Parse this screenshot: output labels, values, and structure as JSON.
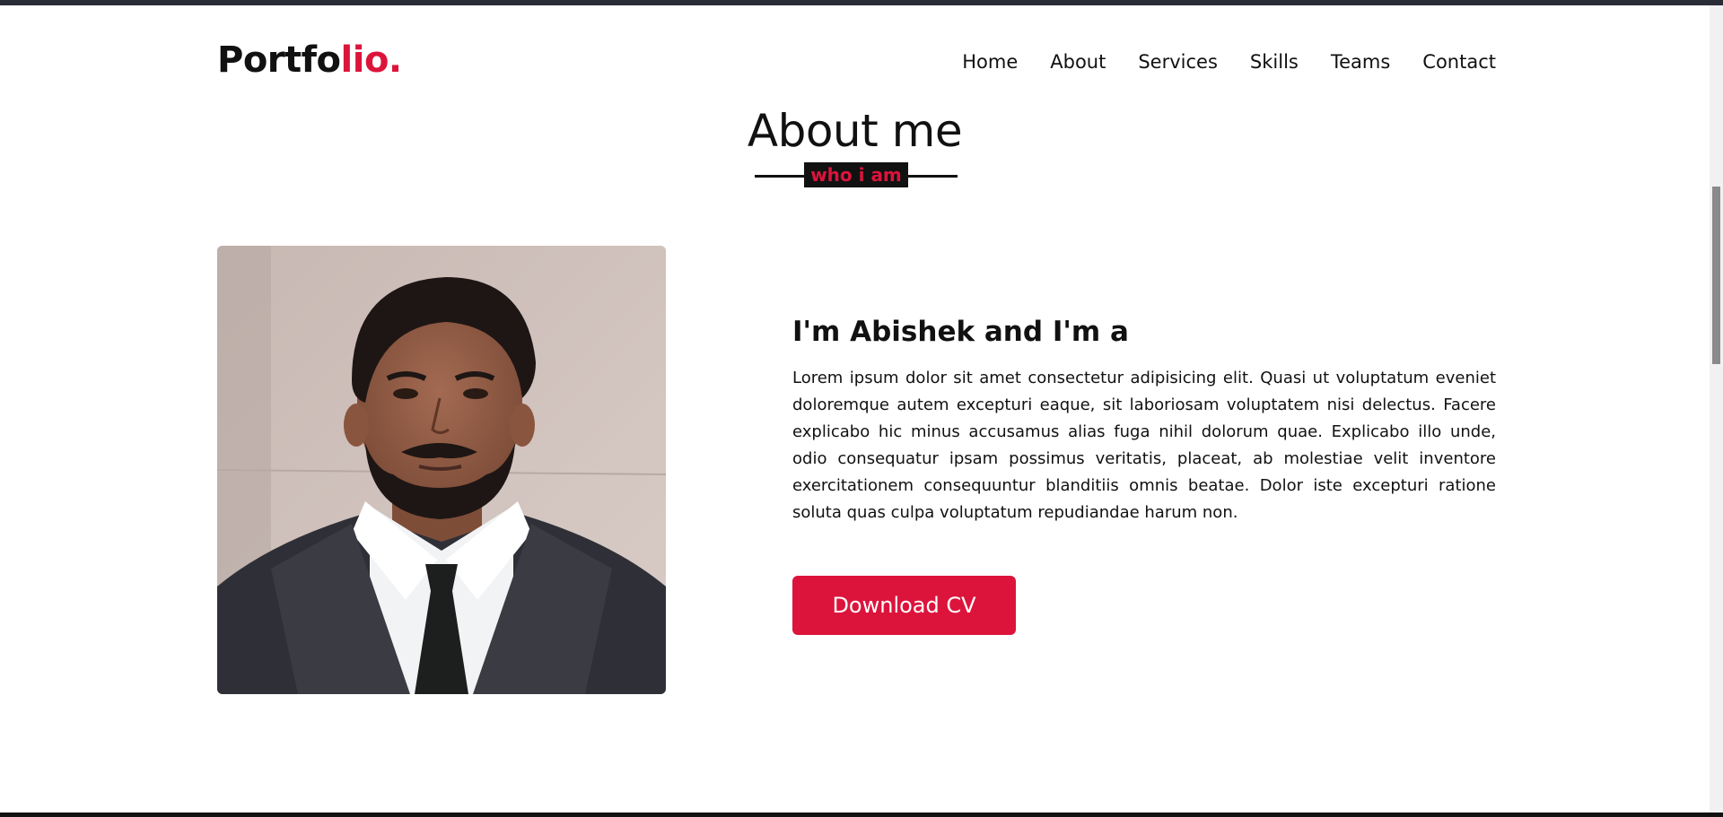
{
  "brand": {
    "logo_main": "Portfo",
    "logo_accent": "lio."
  },
  "nav": {
    "items": [
      {
        "label": "Home"
      },
      {
        "label": "About"
      },
      {
        "label": "Services"
      },
      {
        "label": "Skills"
      },
      {
        "label": "Teams"
      },
      {
        "label": "Contact"
      }
    ]
  },
  "about": {
    "title": "About me",
    "subtitle": "who i am",
    "heading": "I'm Abishek and I'm a",
    "paragraph": "Lorem ipsum dolor sit amet consectetur adipisicing elit. Quasi ut voluptatum eveniet doloremque autem excepturi eaque, sit laboriosam voluptatem nisi delectus. Facere explicabo hic minus accusamus alias fuga nihil dolorum quae. Explicabo illo unde, odio consequatur ipsam possimus veritatis, placeat, ab molestiae velit inventore exercitationem consequuntur blanditiis omnis beatae. Dolor iste excepturi ratione soluta quas culpa voluptatum repudiandae harum non.",
    "button_label": "Download CV"
  },
  "colors": {
    "accent": "#dc143c",
    "text": "#111111",
    "background": "#ffffff"
  }
}
